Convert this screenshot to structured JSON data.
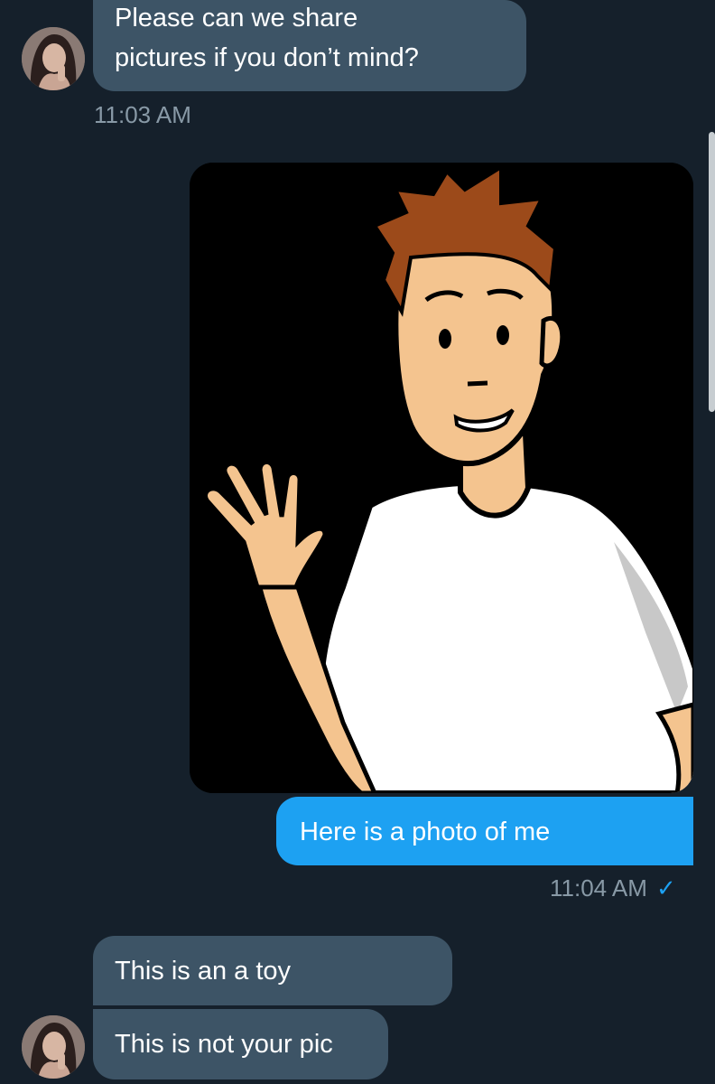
{
  "messages": {
    "m1": {
      "text_line1": "Please can we share",
      "text_line2": "pictures if you don’t mind?",
      "time": "11:03 AM"
    },
    "m2": {
      "text": "Here is a photo of me",
      "time": "11:04 AM",
      "read_check": "✓"
    },
    "m3": {
      "text": "This is an a toy"
    },
    "m4": {
      "text": "This is not your pic"
    }
  },
  "colors": {
    "background": "#15202b",
    "incoming_bubble": "#3d5466",
    "outgoing_bubble": "#1da1f2",
    "timestamp": "#8899a6"
  },
  "icons": {
    "read_receipt": "check-icon",
    "avatar": "avatar-icon"
  }
}
